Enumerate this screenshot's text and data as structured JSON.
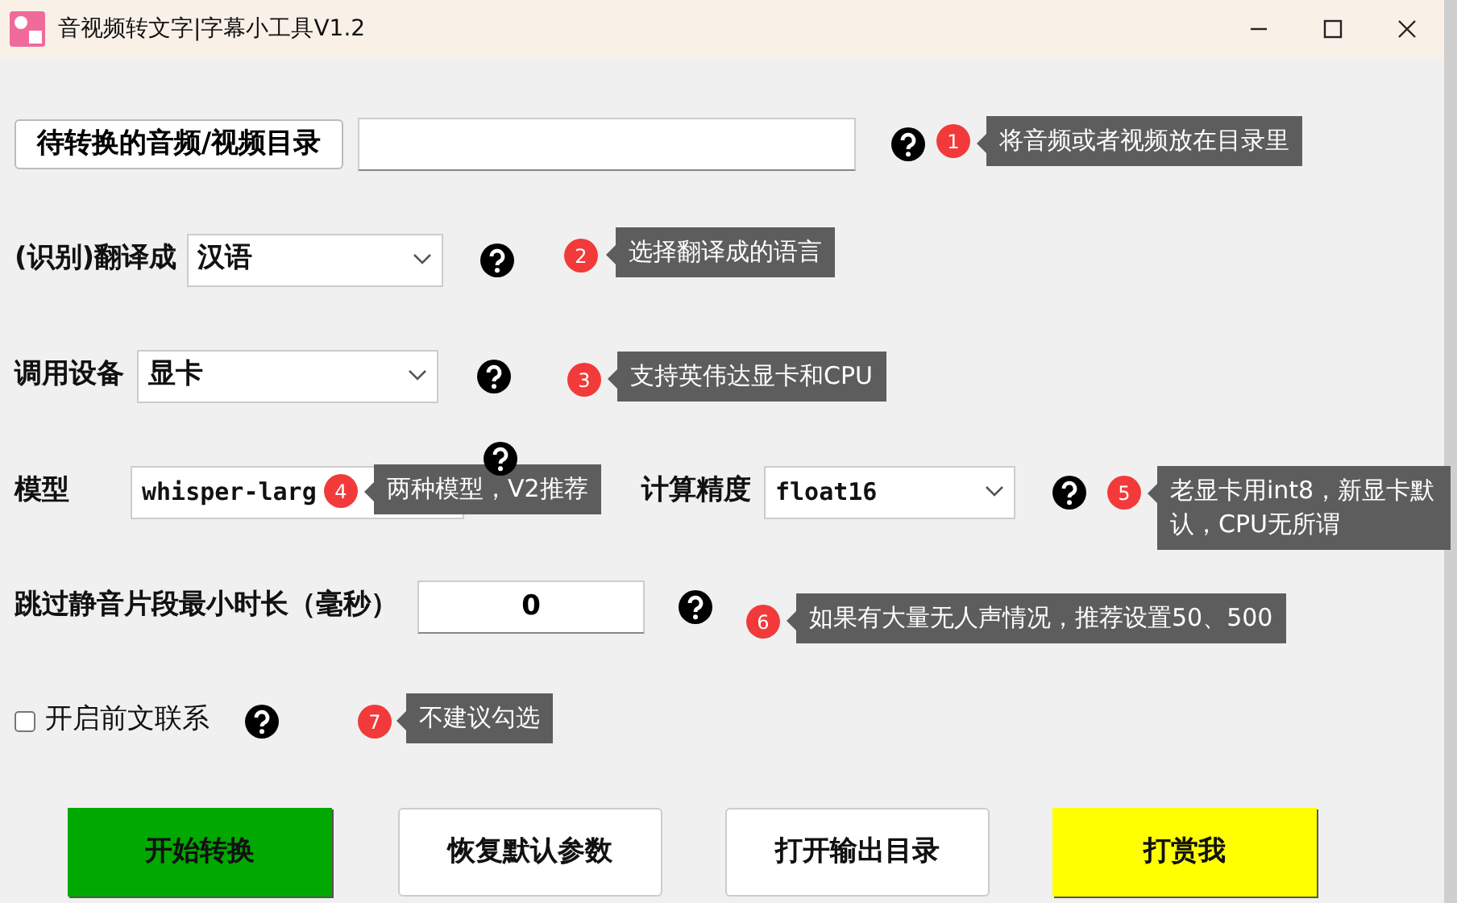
{
  "window": {
    "title": "音视频转文字|字幕小工具V1.2"
  },
  "rows": [
    {
      "kind": "folder",
      "button": "待转换的音频/视频目录",
      "value": ""
    },
    {
      "kind": "select",
      "label": "(识别)翻译成",
      "value": "汉语"
    },
    {
      "kind": "select",
      "label": "调用设备",
      "value": "显卡"
    },
    {
      "kind": "pair",
      "label": "模型",
      "value": "whisper-larg",
      "label2": "计算精度",
      "value2": "float16"
    },
    {
      "kind": "number",
      "label": "跳过静音片段最小时长（毫秒）",
      "value": "0"
    },
    {
      "kind": "checkbox",
      "label": "开启前文联系",
      "checked": false
    }
  ],
  "annotations": [
    {
      "number": "1",
      "text": "将音频或者视频放在目录里"
    },
    {
      "number": "2",
      "text": "选择翻译成的语言"
    },
    {
      "number": "3",
      "text": "支持英伟达显卡和CPU"
    },
    {
      "number": "4",
      "text": "两种模型，V2推荐"
    },
    {
      "number": "5",
      "text": "老显卡用int8，新显卡默认，CPU无所谓"
    },
    {
      "number": "6",
      "text": "如果有大量无人声情况，推荐设置50、500"
    },
    {
      "number": "7",
      "text": "不建议勾选"
    }
  ],
  "buttons": [
    {
      "label": "开始转换",
      "color": "#00a800"
    },
    {
      "label": "恢复默认参数",
      "color": "#ffffff"
    },
    {
      "label": "打开输出目录",
      "color": "#ffffff"
    },
    {
      "label": "打赏我",
      "color": "#ffff00"
    }
  ]
}
